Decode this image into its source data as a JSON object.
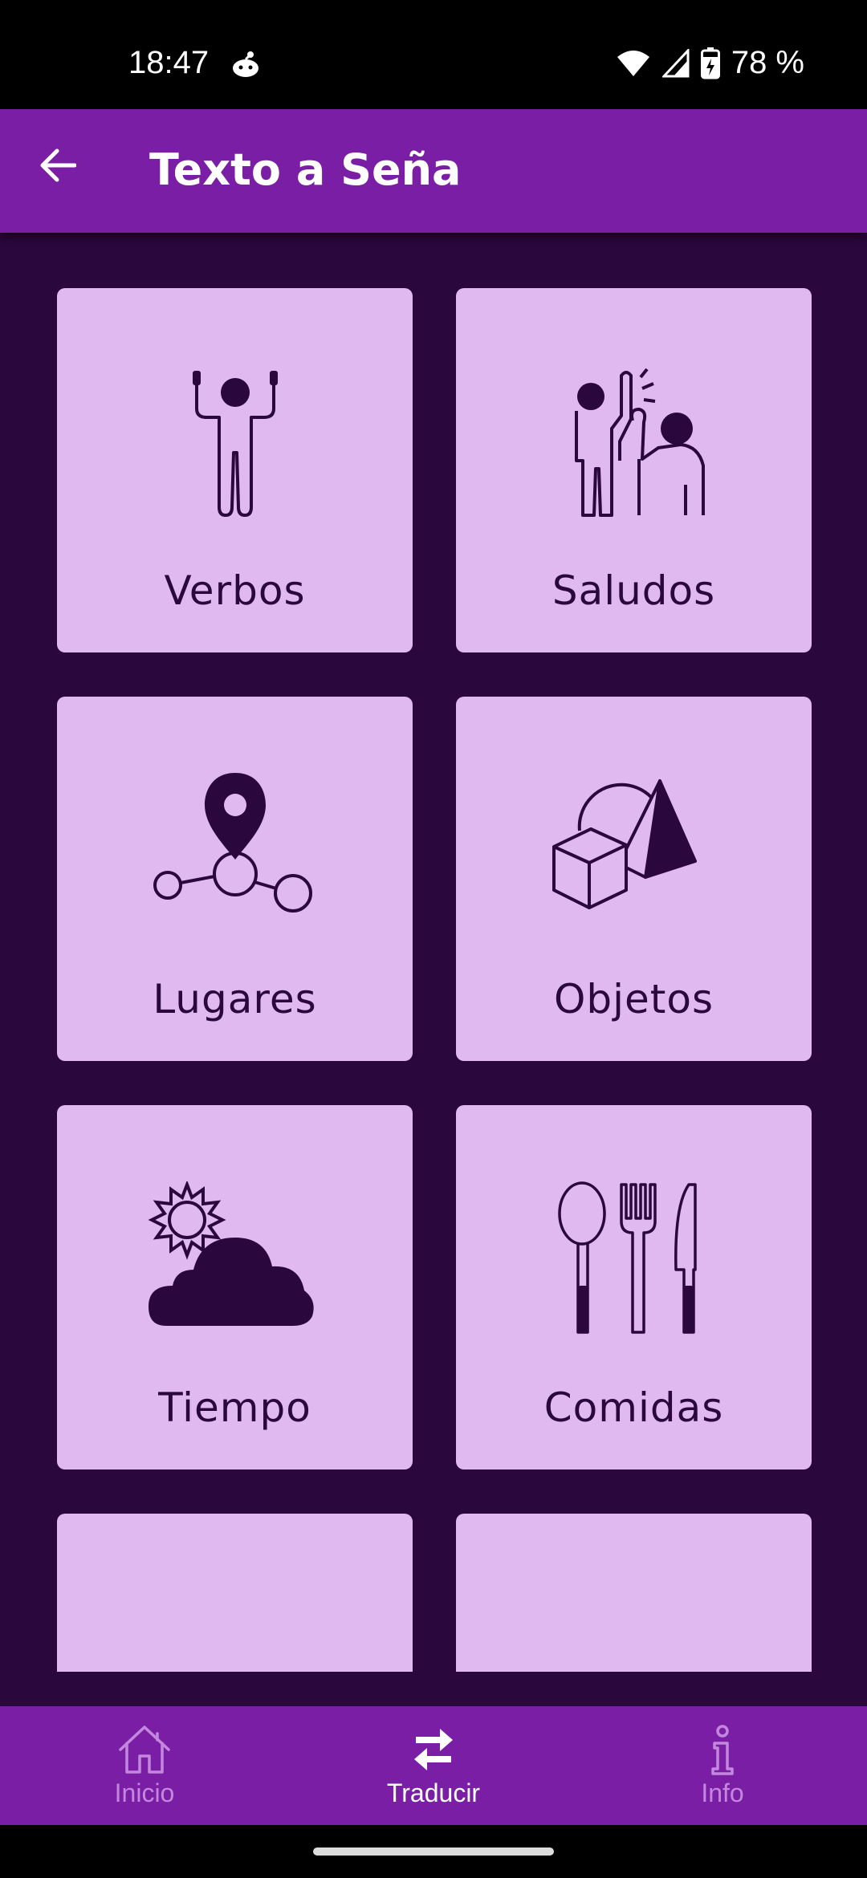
{
  "status_bar": {
    "time": "18:47",
    "battery": "78 %"
  },
  "app_bar": {
    "title": "Texto a Seña"
  },
  "categories": [
    {
      "label": "Verbos",
      "icon": "person-arms-up-icon"
    },
    {
      "label": "Saludos",
      "icon": "people-greeting-icon"
    },
    {
      "label": "Lugares",
      "icon": "location-pin-network-icon"
    },
    {
      "label": "Objetos",
      "icon": "shapes-icon"
    },
    {
      "label": "Tiempo",
      "icon": "sun-cloud-icon"
    },
    {
      "label": "Comidas",
      "icon": "cutlery-icon"
    },
    {
      "label": "",
      "icon": "theater-masks-icon"
    },
    {
      "label": "",
      "icon": "calendar-icon"
    }
  ],
  "bottom_nav": {
    "items": [
      {
        "label": "Inicio",
        "icon": "home-icon",
        "active": false
      },
      {
        "label": "Traducir",
        "icon": "swap-arrows-icon",
        "active": true
      },
      {
        "label": "Info",
        "icon": "info-icon",
        "active": false
      }
    ]
  },
  "colors": {
    "app_bar": "#7a1ea6",
    "background": "#2a073d",
    "card": "#dfb9ef",
    "icon": "#2a073d",
    "nav_inactive": "#c388de"
  }
}
